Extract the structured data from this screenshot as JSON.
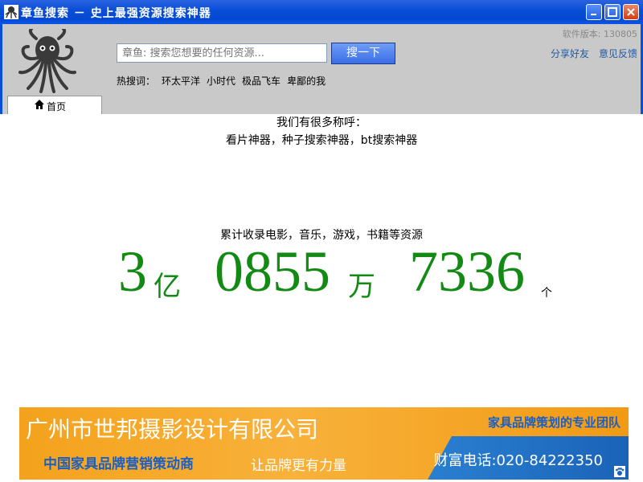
{
  "window": {
    "title": "章鱼搜索 － 史上最强资源搜索神器"
  },
  "header": {
    "search_placeholder": "章鱼: 搜索您想要的任何资源...",
    "search_button": "搜一下",
    "hot_label": "热搜词：",
    "hot_terms": [
      "环太平洋",
      "小时代",
      "极品飞车",
      "卑鄙的我"
    ],
    "version": "软件版本: 130805",
    "share": "分享好友",
    "feedback": "意见反馈"
  },
  "tab": {
    "home": "首页"
  },
  "content": {
    "slogan_line1": "我们有很多称呼：",
    "slogan_line2": "看片神器，种子搜索神器，bt搜索神器",
    "total_label": "累计收录电影，音乐，游戏，书籍等资源",
    "count": {
      "yi": "3",
      "yi_unit": "亿",
      "wan": "0855",
      "wan_unit": "万",
      "ge": "7336",
      "ge_unit": "个"
    }
  },
  "banner": {
    "company": "广州市世邦摄影设计有限公司",
    "tagline": "家具品牌策划的专业团队",
    "sub1": "中国家具品牌营销策动商",
    "sub2": "让品牌更有力量",
    "phone": "财富电话:020-84222350"
  },
  "colors": {
    "titlebar": "#0a4fd8",
    "counter": "#138a13",
    "link": "#1f5aa8",
    "banner": "#f4a21c"
  }
}
